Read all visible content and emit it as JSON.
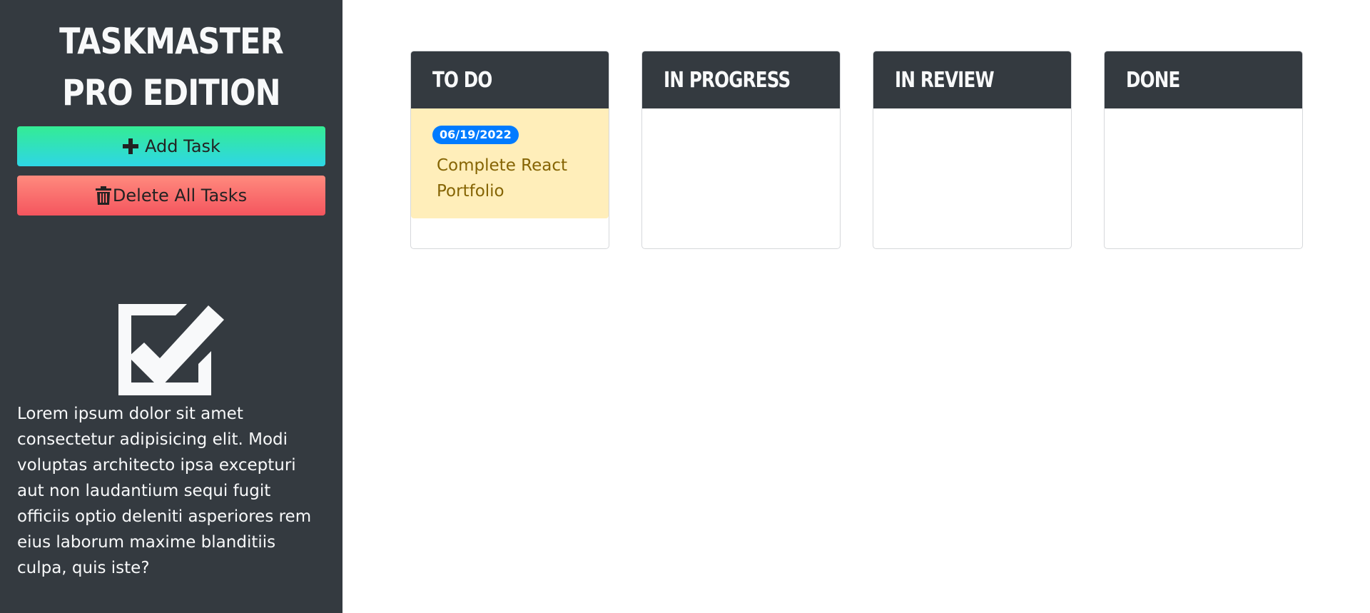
{
  "sidebar": {
    "title": "TASKMASTER PRO EDITION",
    "add_button_label": "Add Task",
    "delete_button_label": "Delete All Tasks",
    "about_text": "Lorem ipsum dolor sit amet consectetur adipisicing elit. Modi voluptas architecto ipsa excepturi aut non laudantium sequi fugit officiis optio deleniti asperiores rem eius laborum maxime blanditiis culpa, quis iste?",
    "icons": {
      "add": "plus-icon",
      "delete": "trash-icon",
      "logo": "check-square-icon"
    }
  },
  "board": {
    "columns": [
      {
        "title": "TO DO",
        "tasks": [
          {
            "date": "06/19/2022",
            "title": "Complete React Portfolio"
          }
        ]
      },
      {
        "title": "IN PROGRESS",
        "tasks": []
      },
      {
        "title": "IN REVIEW",
        "tasks": []
      },
      {
        "title": "DONE",
        "tasks": []
      }
    ]
  },
  "colors": {
    "sidebar_bg": "#343a40",
    "header_bg": "#343a40",
    "add_button_gradient": [
      "#34ec94",
      "#2ed6e6"
    ],
    "delete_button_gradient": [
      "#ff8a7e",
      "#f4555e"
    ],
    "task_card_bg": "#ffeeba",
    "task_text": "#856404",
    "date_badge_bg": "#007bff"
  }
}
